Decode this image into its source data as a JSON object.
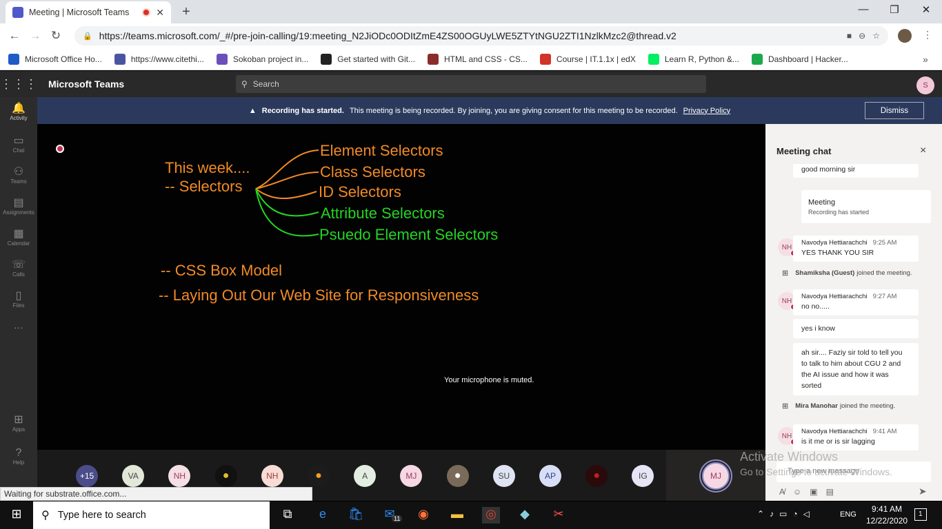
{
  "browser": {
    "tab_title": "Meeting | Microsoft Teams",
    "new_tab": "+",
    "url": "https://teams.microsoft.com/_#/pre-join-calling/19:meeting_N2JiODc0ODItZmE4ZS00OGUyLWE5ZTYtNGU2ZTI1NzlkMzc2@thread.v2",
    "bookmarks": [
      {
        "label": "Microsoft Office Ho...",
        "color": "#1e5bc6"
      },
      {
        "label": "https://www.citethi...",
        "color": "#4a55a2"
      },
      {
        "label": "Sokoban project in...",
        "color": "#6b4fbb"
      },
      {
        "label": "Get started with Git...",
        "color": "#222222"
      },
      {
        "label": "HTML and CSS - CS...",
        "color": "#8c2b2b"
      },
      {
        "label": "Course | IT.1.1x | edX",
        "color": "#d23228"
      },
      {
        "label": "Learn R, Python &...",
        "color": "#03ef62"
      },
      {
        "label": "Dashboard | Hacker...",
        "color": "#1ba94c"
      }
    ],
    "status_text": "Waiting for substrate.office.com..."
  },
  "teams": {
    "app_title": "Microsoft Teams",
    "search_placeholder": "Search",
    "user_initial": "S",
    "rail": [
      "Activity",
      "Chat",
      "Teams",
      "Assignments",
      "Calendar",
      "Calls",
      "Files",
      "...",
      "Apps",
      "Help"
    ]
  },
  "banner": {
    "bold": "Recording has started.",
    "text": "This meeting is being recorded. By joining, you are giving consent for this meeting to be recorded.",
    "link": "Privacy Policy",
    "dismiss": "Dismiss"
  },
  "slide": {
    "intro": "This week....",
    "selectors_heading": "-- Selectors",
    "items": [
      "Element Selectors",
      "Class Selectors",
      "ID Selectors",
      "Attribute Selectors",
      "Psuedo Element Selectors"
    ],
    "box_model": "-- CSS Box Model",
    "layout": "-- Laying Out Our Web Site for Responsiveness"
  },
  "stage": {
    "muted_notice": "Your microphone is muted."
  },
  "participants": [
    {
      "label": "+15",
      "bg": "#4b4d8a",
      "fg": "#ffffff"
    },
    {
      "label": "VA",
      "bg": "#e1e8d8",
      "fg": "#444444"
    },
    {
      "label": "NH",
      "bg": "#f4dfe5",
      "fg": "#a13b5a"
    },
    {
      "label": "",
      "bg": "#111111",
      "fg": "#e0c020"
    },
    {
      "label": "NH",
      "bg": "#f7dcd5",
      "fg": "#a13b3b"
    },
    {
      "label": "",
      "bg": "#1c1c1c",
      "fg": "#f0a020"
    },
    {
      "label": "A",
      "bg": "#e3ede1",
      "fg": "#444444"
    },
    {
      "label": "MJ",
      "bg": "#f6d7e4",
      "fg": "#a13b5a"
    },
    {
      "label": "",
      "bg": "#7a6a5a",
      "fg": "#ffffff"
    },
    {
      "label": "SU",
      "bg": "#dfe4f3",
      "fg": "#444444"
    },
    {
      "label": "AP",
      "bg": "#d8def5",
      "fg": "#33408c"
    },
    {
      "label": "",
      "bg": "#2a0a0a",
      "fg": "#c02020"
    },
    {
      "label": "IG",
      "bg": "#e5e5f5",
      "fg": "#444444"
    }
  ],
  "self_view": "MJ",
  "chat": {
    "title": "Meeting chat",
    "close": "×",
    "items": [
      {
        "kind": "msg",
        "text": "good morning sir"
      },
      {
        "kind": "card",
        "title": "Meeting",
        "sub": "Recording has started"
      },
      {
        "kind": "named",
        "initials": "NH",
        "sender": "Navodya Hettiarachchi",
        "time": "9:25 AM",
        "text": "YES THANK YOU SIR"
      },
      {
        "kind": "event",
        "name": "Shamiksha (Guest)",
        "text": "joined the meeting."
      },
      {
        "kind": "named",
        "initials": "NH",
        "sender": "Navodya Hettiarachchi",
        "time": "9:27 AM",
        "text": "no no....."
      },
      {
        "kind": "msg",
        "text": "yes i know"
      },
      {
        "kind": "msg",
        "text": "ah sir.... Faziy sir told to tell you to talk to him about CGU 2 and the AI issue and how it was sorted"
      },
      {
        "kind": "event",
        "name": "Mira Manohar",
        "text": "joined the meeting."
      },
      {
        "kind": "named",
        "initials": "NH",
        "sender": "Navodya Hettiarachchi",
        "time": "9:41 AM",
        "text": "is it me or is sir lagging"
      }
    ],
    "compose_placeholder": "Type a new message"
  },
  "watermark": {
    "line1": "Activate Windows",
    "line2": "Go to Settings to activate Windows."
  },
  "taskbar": {
    "search_placeholder": "Type here to search",
    "mail_badge": "11",
    "language": "ENG",
    "time": "9:41 AM",
    "date": "12/22/2020",
    "notifications": "1"
  }
}
